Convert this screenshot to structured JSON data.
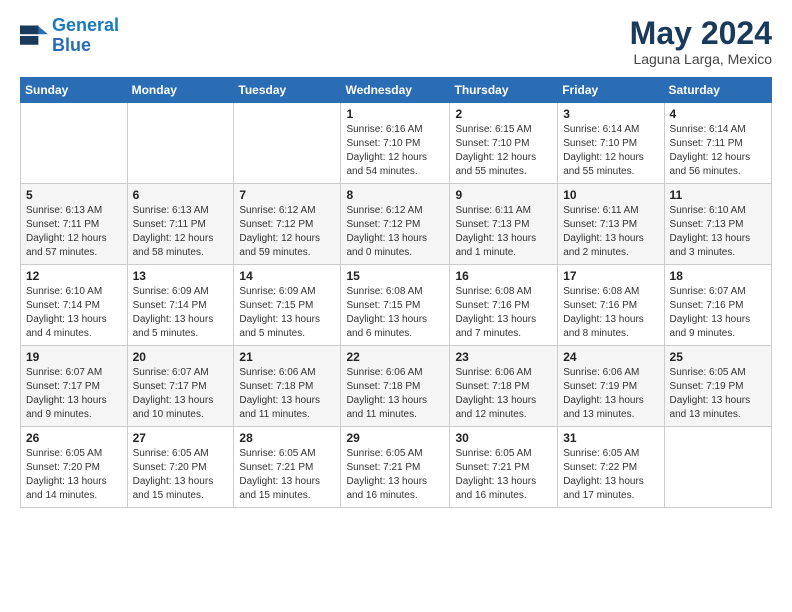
{
  "header": {
    "logo_line1": "General",
    "logo_line2": "Blue",
    "month_title": "May 2024",
    "location": "Laguna Larga, Mexico"
  },
  "days_of_week": [
    "Sunday",
    "Monday",
    "Tuesday",
    "Wednesday",
    "Thursday",
    "Friday",
    "Saturday"
  ],
  "weeks": [
    [
      {
        "num": "",
        "info": ""
      },
      {
        "num": "",
        "info": ""
      },
      {
        "num": "",
        "info": ""
      },
      {
        "num": "1",
        "info": "Sunrise: 6:16 AM\nSunset: 7:10 PM\nDaylight: 12 hours\nand 54 minutes."
      },
      {
        "num": "2",
        "info": "Sunrise: 6:15 AM\nSunset: 7:10 PM\nDaylight: 12 hours\nand 55 minutes."
      },
      {
        "num": "3",
        "info": "Sunrise: 6:14 AM\nSunset: 7:10 PM\nDaylight: 12 hours\nand 55 minutes."
      },
      {
        "num": "4",
        "info": "Sunrise: 6:14 AM\nSunset: 7:11 PM\nDaylight: 12 hours\nand 56 minutes."
      }
    ],
    [
      {
        "num": "5",
        "info": "Sunrise: 6:13 AM\nSunset: 7:11 PM\nDaylight: 12 hours\nand 57 minutes."
      },
      {
        "num": "6",
        "info": "Sunrise: 6:13 AM\nSunset: 7:11 PM\nDaylight: 12 hours\nand 58 minutes."
      },
      {
        "num": "7",
        "info": "Sunrise: 6:12 AM\nSunset: 7:12 PM\nDaylight: 12 hours\nand 59 minutes."
      },
      {
        "num": "8",
        "info": "Sunrise: 6:12 AM\nSunset: 7:12 PM\nDaylight: 13 hours\nand 0 minutes."
      },
      {
        "num": "9",
        "info": "Sunrise: 6:11 AM\nSunset: 7:13 PM\nDaylight: 13 hours\nand 1 minute."
      },
      {
        "num": "10",
        "info": "Sunrise: 6:11 AM\nSunset: 7:13 PM\nDaylight: 13 hours\nand 2 minutes."
      },
      {
        "num": "11",
        "info": "Sunrise: 6:10 AM\nSunset: 7:13 PM\nDaylight: 13 hours\nand 3 minutes."
      }
    ],
    [
      {
        "num": "12",
        "info": "Sunrise: 6:10 AM\nSunset: 7:14 PM\nDaylight: 13 hours\nand 4 minutes."
      },
      {
        "num": "13",
        "info": "Sunrise: 6:09 AM\nSunset: 7:14 PM\nDaylight: 13 hours\nand 5 minutes."
      },
      {
        "num": "14",
        "info": "Sunrise: 6:09 AM\nSunset: 7:15 PM\nDaylight: 13 hours\nand 5 minutes."
      },
      {
        "num": "15",
        "info": "Sunrise: 6:08 AM\nSunset: 7:15 PM\nDaylight: 13 hours\nand 6 minutes."
      },
      {
        "num": "16",
        "info": "Sunrise: 6:08 AM\nSunset: 7:16 PM\nDaylight: 13 hours\nand 7 minutes."
      },
      {
        "num": "17",
        "info": "Sunrise: 6:08 AM\nSunset: 7:16 PM\nDaylight: 13 hours\nand 8 minutes."
      },
      {
        "num": "18",
        "info": "Sunrise: 6:07 AM\nSunset: 7:16 PM\nDaylight: 13 hours\nand 9 minutes."
      }
    ],
    [
      {
        "num": "19",
        "info": "Sunrise: 6:07 AM\nSunset: 7:17 PM\nDaylight: 13 hours\nand 9 minutes."
      },
      {
        "num": "20",
        "info": "Sunrise: 6:07 AM\nSunset: 7:17 PM\nDaylight: 13 hours\nand 10 minutes."
      },
      {
        "num": "21",
        "info": "Sunrise: 6:06 AM\nSunset: 7:18 PM\nDaylight: 13 hours\nand 11 minutes."
      },
      {
        "num": "22",
        "info": "Sunrise: 6:06 AM\nSunset: 7:18 PM\nDaylight: 13 hours\nand 11 minutes."
      },
      {
        "num": "23",
        "info": "Sunrise: 6:06 AM\nSunset: 7:18 PM\nDaylight: 13 hours\nand 12 minutes."
      },
      {
        "num": "24",
        "info": "Sunrise: 6:06 AM\nSunset: 7:19 PM\nDaylight: 13 hours\nand 13 minutes."
      },
      {
        "num": "25",
        "info": "Sunrise: 6:05 AM\nSunset: 7:19 PM\nDaylight: 13 hours\nand 13 minutes."
      }
    ],
    [
      {
        "num": "26",
        "info": "Sunrise: 6:05 AM\nSunset: 7:20 PM\nDaylight: 13 hours\nand 14 minutes."
      },
      {
        "num": "27",
        "info": "Sunrise: 6:05 AM\nSunset: 7:20 PM\nDaylight: 13 hours\nand 15 minutes."
      },
      {
        "num": "28",
        "info": "Sunrise: 6:05 AM\nSunset: 7:21 PM\nDaylight: 13 hours\nand 15 minutes."
      },
      {
        "num": "29",
        "info": "Sunrise: 6:05 AM\nSunset: 7:21 PM\nDaylight: 13 hours\nand 16 minutes."
      },
      {
        "num": "30",
        "info": "Sunrise: 6:05 AM\nSunset: 7:21 PM\nDaylight: 13 hours\nand 16 minutes."
      },
      {
        "num": "31",
        "info": "Sunrise: 6:05 AM\nSunset: 7:22 PM\nDaylight: 13 hours\nand 17 minutes."
      },
      {
        "num": "",
        "info": ""
      }
    ]
  ]
}
